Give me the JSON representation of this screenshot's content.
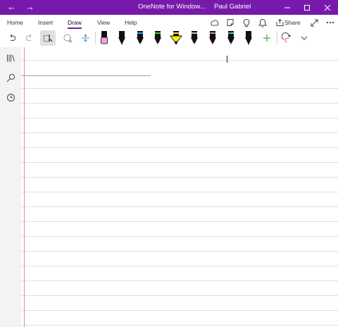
{
  "window": {
    "title": "OneNote for Window...",
    "user": "Paul Gabriel",
    "accent_color": "#7719aa",
    "back_icon": "back-arrow-icon",
    "forward_icon": "forward-arrow-icon",
    "controls": [
      "minimize-icon",
      "maximize-icon",
      "close-icon"
    ]
  },
  "menu": {
    "tabs": [
      {
        "label": "Home"
      },
      {
        "label": "Insert"
      },
      {
        "label": "Draw",
        "active": true
      },
      {
        "label": "View"
      },
      {
        "label": "Help"
      }
    ],
    "right_icons": [
      "sticky-notes-icon",
      "notebook-icon",
      "lightbulb-icon",
      "bell-icon"
    ],
    "share_label": "Share",
    "expand_icon": "expand-icon",
    "more_icon": "more-icon"
  },
  "ribbon": {
    "tools": [
      "undo-icon",
      "redo-icon",
      "lasso-select-icon",
      "lasso-ink-icon",
      "insert-space-icon"
    ],
    "pens": [
      {
        "name": "eraser",
        "color": "#f0a0e0"
      },
      {
        "name": "pen-black",
        "color": "#111111"
      },
      {
        "name": "pen-blue",
        "color": "#2aa7e8"
      },
      {
        "name": "pen-green",
        "color": "#3cc93c"
      },
      {
        "name": "highlighter-yellow",
        "color": "#ffee00"
      },
      {
        "name": "pen-silver",
        "color": "#9a9a9a"
      },
      {
        "name": "pen-galaxy",
        "color": "#e84c4c"
      },
      {
        "name": "pen-ocean",
        "color": "#3fa6d8"
      },
      {
        "name": "pen-black-2",
        "color": "#111111"
      }
    ],
    "add_pen_icon": "add-pen-icon",
    "ink_to_shape_icon": "ink-to-shape-icon",
    "more_icon": "chevron-down-icon"
  },
  "sidebar": {
    "items": [
      "notebooks-icon",
      "search-icon",
      "recent-icon"
    ]
  }
}
